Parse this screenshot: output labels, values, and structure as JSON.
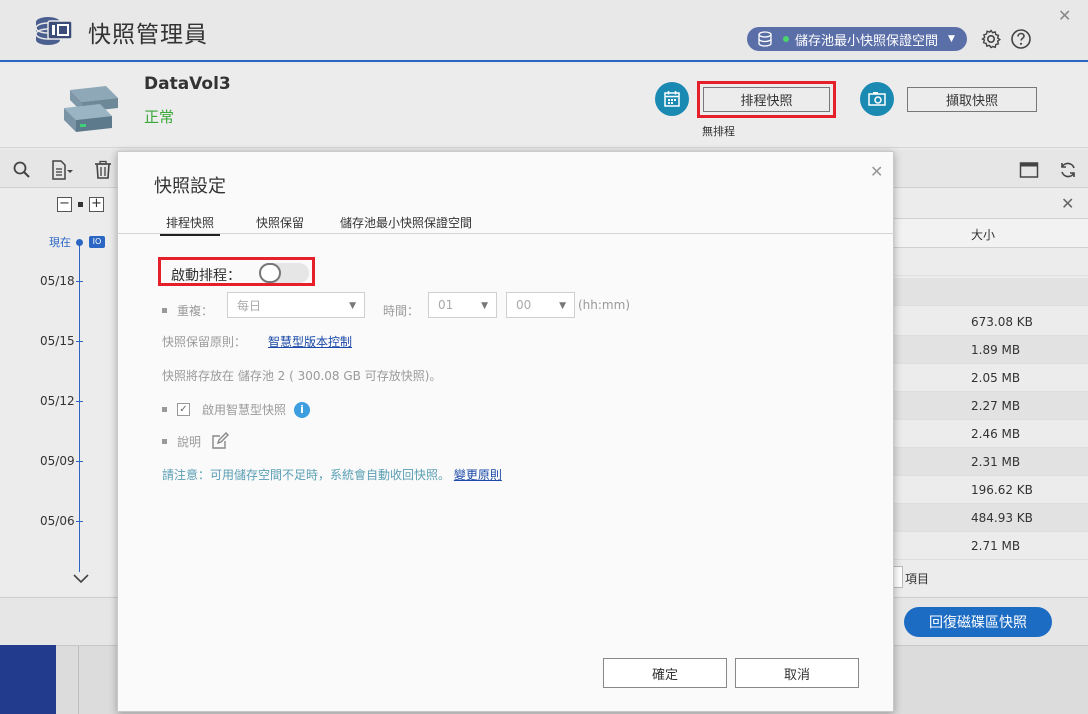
{
  "app": {
    "title": "快照管理員",
    "pool_badge_label": "儲存池最小快照保證空間"
  },
  "volume": {
    "name": "DataVol3",
    "status": "正常",
    "schedule_button": "排程快照",
    "schedule_status": "無排程",
    "take_button": "擷取快照"
  },
  "timeline": {
    "now_label": "現在",
    "dates": [
      "05/18",
      "05/15",
      "05/12",
      "05/09",
      "05/06"
    ]
  },
  "right_panel": {
    "size_header": "大小",
    "sizes": [
      "673.08 KB",
      "1.89 MB",
      "2.05 MB",
      "2.27 MB",
      "2.46 MB",
      "2.31 MB",
      "196.62 KB",
      "484.93 KB",
      "2.71 MB"
    ],
    "items_label": "項目",
    "restore_button": "回復磁碟區快照"
  },
  "modal": {
    "title": "快照設定",
    "tabs": [
      "排程快照",
      "快照保留",
      "儲存池最小快照保證空間"
    ],
    "enable_schedule_label": "啟動排程：",
    "enable_schedule_on": false,
    "repeat_label": "重複：",
    "repeat_value": "每日",
    "time_label": "時間：",
    "hour_value": "01",
    "minute_value": "00",
    "time_format": "(hh:mm)",
    "retention_label": "快照保留原則：",
    "retention_link": "智慧型版本控制",
    "storage_info": "快照將存放在 儲存池 2 ( 300.08 GB 可存放快照)。",
    "smart_snapshot_label": "啟用智慧型快照",
    "smart_snapshot_checked": true,
    "description_label": "說明",
    "note_text": "請注意：可用儲存空間不足時，系統會自動收回快照。",
    "note_link": "變更原則",
    "ok_button": "確定",
    "cancel_button": "取消"
  }
}
